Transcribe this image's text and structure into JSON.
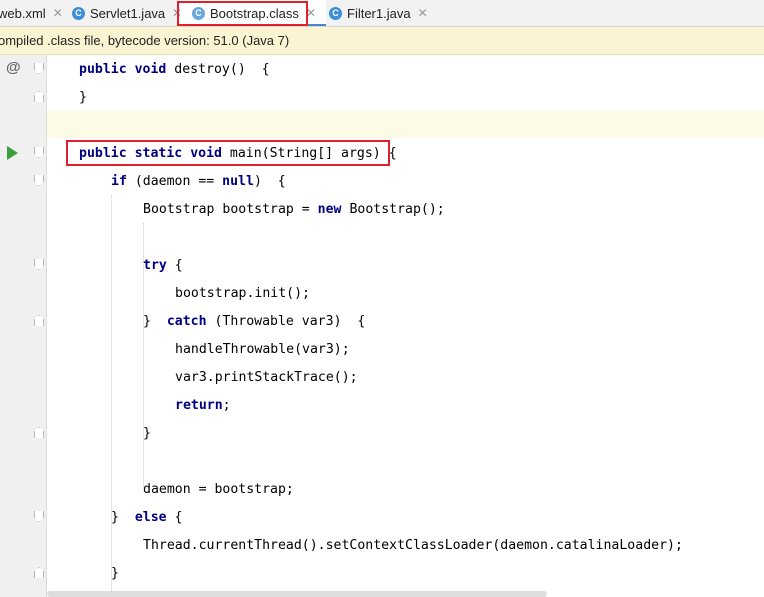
{
  "tabs": [
    {
      "label": "web.xml",
      "icon": "xml-file-icon"
    },
    {
      "label": "Servlet1.java",
      "icon": "java-class-icon"
    },
    {
      "label": "Bootstrap.class",
      "icon": "compiled-class-icon",
      "active": true
    },
    {
      "label": "Filter1.java",
      "icon": "java-class-icon"
    }
  ],
  "close_glyph": "✕",
  "banner": {
    "text": "ompiled .class file, bytecode version: 51.0 (Java 7)"
  },
  "gutter": {
    "override_glyph": "@"
  },
  "code": {
    "l1": {
      "kw1": "public",
      "kw2": "void",
      "rest": " destroy()  {"
    },
    "l2": {
      "rest": "}"
    },
    "l4": {
      "kw1": "public",
      "kw2": "static",
      "kw3": "void",
      "rest": " main(String[] args)",
      "tail": " {"
    },
    "l5": {
      "kw1": "if",
      "rest1": " (daemon == ",
      "kw2": "null",
      "rest2": ")  {"
    },
    "l6": {
      "rest1": "Bootstrap bootstrap = ",
      "kw": "new",
      "rest2": " Bootstrap();"
    },
    "l8": {
      "kw": "try",
      "rest": " {"
    },
    "l9": {
      "rest": "bootstrap.init();"
    },
    "l10": {
      "pre": "}  ",
      "kw": "catch",
      "rest": " (Throwable var3)  {"
    },
    "l11": {
      "rest": "handleThrowable(var3);"
    },
    "l12": {
      "rest": "var3.printStackTrace();"
    },
    "l13": {
      "kw": "return",
      "rest": ";"
    },
    "l14": {
      "rest": "}"
    },
    "l16": {
      "rest": "daemon = bootstrap;"
    },
    "l17": {
      "pre": "}  ",
      "kw": "else",
      "rest": " {"
    },
    "l18": {
      "rest": "Thread.currentThread().setContextClassLoader(daemon.catalinaLoader);"
    },
    "l19": {
      "rest": "}"
    }
  }
}
